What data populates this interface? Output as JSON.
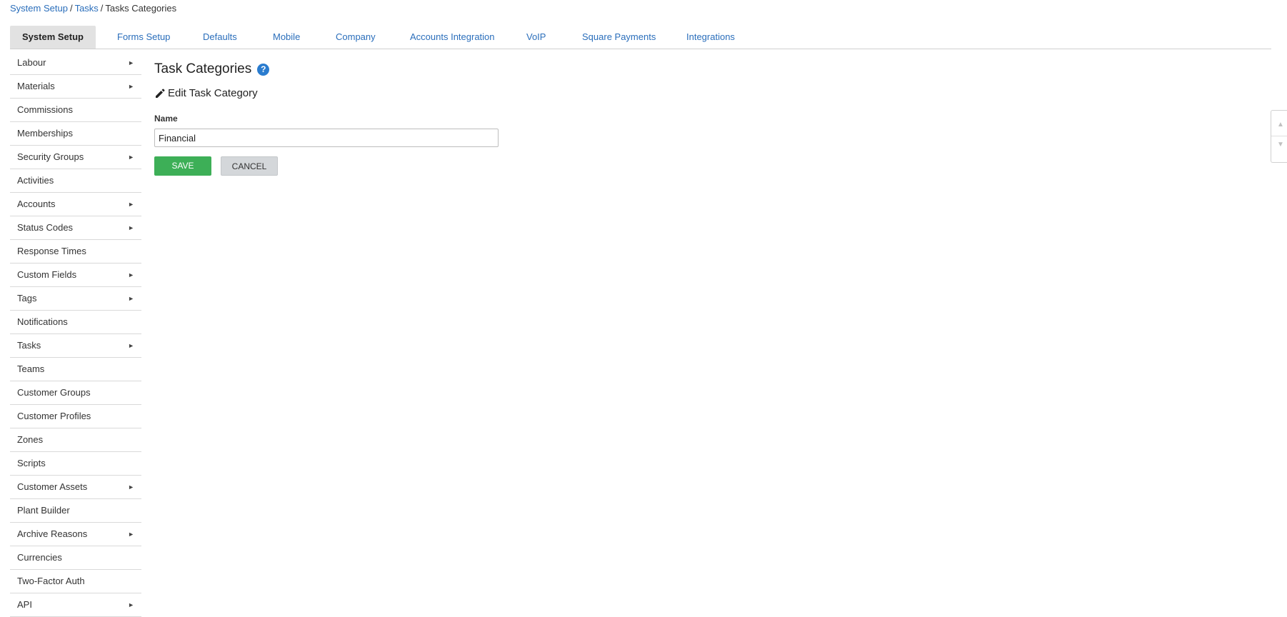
{
  "breadcrumb": {
    "items": [
      "System Setup",
      "Tasks"
    ],
    "current": "Tasks Categories"
  },
  "tabs": [
    {
      "label": "System Setup",
      "active": true
    },
    {
      "label": "Forms Setup"
    },
    {
      "label": "Defaults"
    },
    {
      "label": "Mobile"
    },
    {
      "label": "Company"
    },
    {
      "label": "Accounts Integration"
    },
    {
      "label": "VoIP"
    },
    {
      "label": "Square Payments"
    },
    {
      "label": "Integrations"
    }
  ],
  "sidebar": {
    "items": [
      {
        "label": "Labour",
        "submenu": true
      },
      {
        "label": "Materials",
        "submenu": true
      },
      {
        "label": "Commissions"
      },
      {
        "label": "Memberships"
      },
      {
        "label": "Security Groups",
        "submenu": true
      },
      {
        "label": "Activities"
      },
      {
        "label": "Accounts",
        "submenu": true
      },
      {
        "label": "Status Codes",
        "submenu": true
      },
      {
        "label": "Response Times"
      },
      {
        "label": "Custom Fields",
        "submenu": true
      },
      {
        "label": "Tags",
        "submenu": true
      },
      {
        "label": "Notifications"
      },
      {
        "label": "Tasks",
        "submenu": true
      },
      {
        "label": "Teams"
      },
      {
        "label": "Customer Groups"
      },
      {
        "label": "Customer Profiles"
      },
      {
        "label": "Zones"
      },
      {
        "label": "Scripts"
      },
      {
        "label": "Customer Assets",
        "submenu": true
      },
      {
        "label": "Plant Builder"
      },
      {
        "label": "Archive Reasons",
        "submenu": true
      },
      {
        "label": "Currencies"
      },
      {
        "label": "Two-Factor Auth"
      },
      {
        "label": "API",
        "submenu": true
      }
    ]
  },
  "main": {
    "title": "Task Categories",
    "help_glyph": "?",
    "subtitle": "Edit Task Category",
    "form": {
      "name_label": "Name",
      "name_value": "Financial"
    },
    "save_label": "SAVE",
    "cancel_label": "CANCEL"
  },
  "icons": {
    "help": "question-circle-icon",
    "edit": "pencil-icon",
    "submenu": "caret-right-icon",
    "scroll_up": "triangle-up-icon",
    "scroll_down": "triangle-down-icon"
  },
  "colors": {
    "link": "#2a6ebb",
    "save": "#3daf57",
    "help": "#2a7ccf",
    "active_tab": "#e2e2e2"
  }
}
